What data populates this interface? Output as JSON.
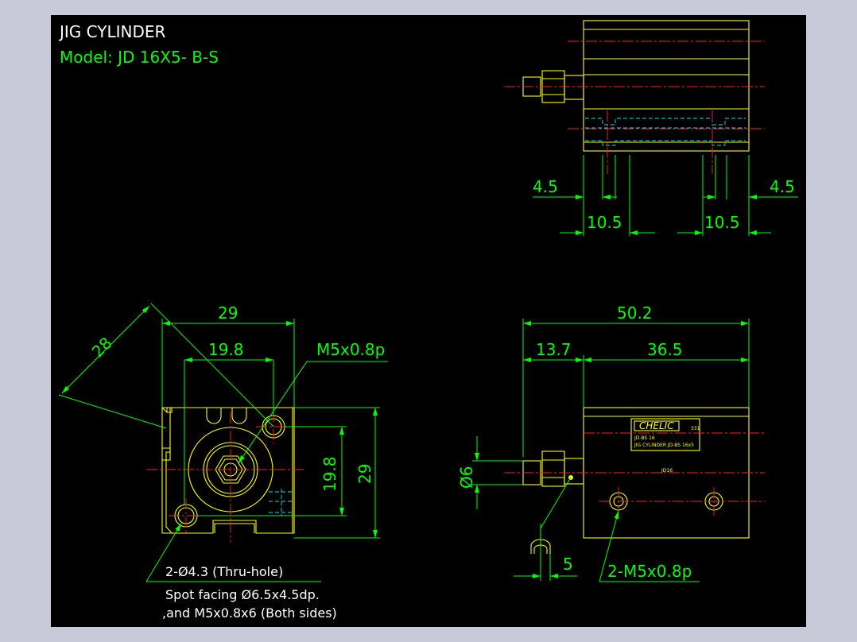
{
  "title": "JIG CYLINDER",
  "model": "Model:  JD 16X5- B-S",
  "colors": {
    "background": "#000000",
    "frame": "#c8c9d9",
    "dimension": "#00ff00",
    "outline": "#ffff00",
    "centerline": "#ff2020",
    "hidden": "#00e5ff",
    "note": "#ffffff"
  },
  "top_view": {
    "dims": [
      "4.5",
      "4.5",
      "10.5",
      "10.5"
    ]
  },
  "front_view": {
    "dims": [
      "28",
      "29",
      "19.8",
      "19.8",
      "29"
    ],
    "port_callout": "M5x0.8p",
    "hole_note": [
      "2-Ø4.3 (Thru-hole)",
      "Spot facing Ø6.5x4.5dp.",
      ",and M5x0.8x6 (Both sides)"
    ]
  },
  "side_view": {
    "dims": [
      "50.2",
      "13.7",
      "36.5",
      "Ø6",
      "5"
    ],
    "tap_callout": "2-M5x0.8p",
    "label_brand": "CHELIC",
    "label_code": "331",
    "label_line1": "JD-BS 16",
    "label_line2": "JIG CYLINDER  JD-BS 16x5",
    "body_text": "JD16"
  }
}
